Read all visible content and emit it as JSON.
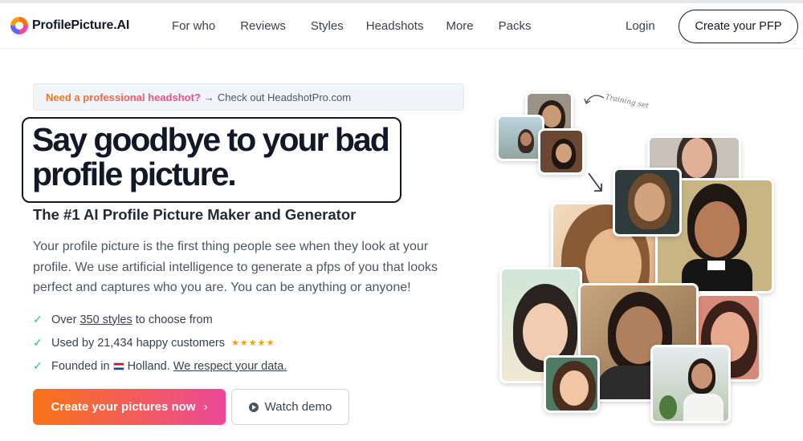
{
  "brand": {
    "name": "ProfilePicture.AI"
  },
  "nav": {
    "items": [
      "For who",
      "Reviews",
      "Styles",
      "Headshots",
      "More",
      "Packs"
    ],
    "login": "Login",
    "cta": "Create your PFP"
  },
  "notice": {
    "strong": "Need a professional headshot?",
    "arrow": "→",
    "rest": "Check out HeadshotPro.com"
  },
  "hero": {
    "headline": "Say goodbye to your bad profile picture.",
    "subheadline": "The #1 AI Profile Picture Maker and Generator",
    "description": "Your profile picture is the first thing people see when they look at your profile. We use artificial intelligence to generate a pfps of you that looks perfect and captures who you are. You can be anything or anyone!"
  },
  "features": {
    "styles_prefix": "Over",
    "styles_link": "350 styles",
    "styles_suffix": "to choose from",
    "customers": "Used by 21,434 happy customers",
    "stars": "★★★★★",
    "founded_prefix": "Founded in",
    "founded_place": "Holland.",
    "data_link": "We respect your data."
  },
  "buttons": {
    "primary": "Create your pictures now",
    "primary_chevron": "›",
    "secondary": "Watch demo"
  },
  "collage": {
    "training_label": "Training set"
  },
  "colors": {
    "accent_start": "#f97316",
    "accent_end": "#ec4899",
    "check": "#22c55e",
    "stars": "#f59e0b"
  }
}
